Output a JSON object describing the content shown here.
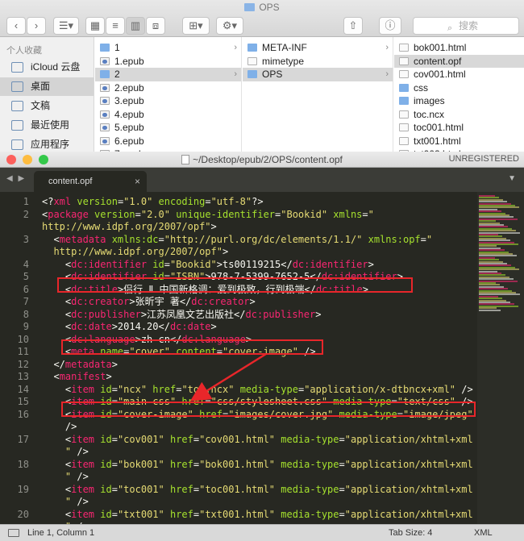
{
  "finder": {
    "title": "OPS",
    "search_placeholder": "搜索",
    "sidebar": {
      "header": "个人收藏",
      "items": [
        {
          "label": "iCloud 云盘",
          "icon": "cloud-icon"
        },
        {
          "label": "桌面",
          "icon": "desktop-icon",
          "selected": true
        },
        {
          "label": "文稿",
          "icon": "documents-icon"
        },
        {
          "label": "最近使用",
          "icon": "clock-icon"
        },
        {
          "label": "应用程序",
          "icon": "applications-icon"
        }
      ]
    },
    "col1": [
      {
        "label": "1",
        "type": "folder",
        "chevron": true
      },
      {
        "label": "1.epub",
        "type": "epub"
      },
      {
        "label": "2",
        "type": "folder",
        "chevron": true,
        "selected": true
      },
      {
        "label": "2.epub",
        "type": "epub"
      },
      {
        "label": "3.epub",
        "type": "epub"
      },
      {
        "label": "4.epub",
        "type": "epub"
      },
      {
        "label": "5.epub",
        "type": "epub"
      },
      {
        "label": "6.epub",
        "type": "epub"
      },
      {
        "label": "7.epub",
        "type": "epub"
      }
    ],
    "col2": [
      {
        "label": "META-INF",
        "type": "folder",
        "chevron": true
      },
      {
        "label": "mimetype",
        "type": "doc"
      },
      {
        "label": "OPS",
        "type": "folder",
        "chevron": true,
        "selected": true
      }
    ],
    "col3": [
      {
        "label": "bok001.html",
        "type": "doc"
      },
      {
        "label": "content.opf",
        "type": "doc",
        "selected": true
      },
      {
        "label": "cov001.html",
        "type": "doc"
      },
      {
        "label": "css",
        "type": "folder"
      },
      {
        "label": "images",
        "type": "folder"
      },
      {
        "label": "toc.ncx",
        "type": "doc"
      },
      {
        "label": "toc001.html",
        "type": "doc"
      },
      {
        "label": "txt001.html",
        "type": "doc"
      },
      {
        "label": "txt002.html",
        "type": "doc"
      }
    ]
  },
  "editor": {
    "window_title": "~/Desktop/epub/2/OPS/content.opf",
    "unregistered": "UNREGISTERED",
    "tab_label": "content.opf",
    "status": {
      "position": "Line 1, Column 1",
      "tab_size": "Tab Size: 4",
      "syntax": "XML"
    },
    "line_numbers": [
      "1",
      "2",
      "3",
      "4",
      "5",
      "6",
      "7",
      "8",
      "9",
      "10",
      "11",
      "12",
      "13",
      "14",
      "15",
      "16",
      "17",
      "18",
      "19",
      "20"
    ],
    "colors": {
      "background": "#272822",
      "tag": "#f92672",
      "attribute": "#a6e22e",
      "string": "#e6db74",
      "text": "#f8f8f2",
      "highlight": "#e8262a"
    },
    "lines": [
      [
        [
          "p",
          "<?"
        ],
        [
          "t",
          "xml"
        ],
        [
          "a",
          " version"
        ],
        [
          "p",
          "="
        ],
        [
          "s",
          "\"1.0\""
        ],
        [
          "a",
          " encoding"
        ],
        [
          "p",
          "="
        ],
        [
          "s",
          "\"utf-8\""
        ],
        [
          "p",
          "?>"
        ]
      ],
      [
        [
          "p",
          "<"
        ],
        [
          "t",
          "package"
        ],
        [
          "a",
          " version"
        ],
        [
          "p",
          "="
        ],
        [
          "s",
          "\"2.0\""
        ],
        [
          "a",
          " unique-identifier"
        ],
        [
          "p",
          "="
        ],
        [
          "s",
          "\"Bookid\""
        ],
        [
          "a",
          " xmlns"
        ],
        [
          "p",
          "="
        ],
        [
          "s",
          "\""
        ]
      ],
      [
        [
          "s",
          "http://www.idpf.org/2007/opf\""
        ],
        [
          "p",
          ">"
        ]
      ],
      [
        [
          "p",
          "  <"
        ],
        [
          "t",
          "metadata"
        ],
        [
          "a",
          " xmlns:dc"
        ],
        [
          "p",
          "="
        ],
        [
          "s",
          "\"http://purl.org/dc/elements/1.1/\""
        ],
        [
          "a",
          " xmlns:opf"
        ],
        [
          "p",
          "="
        ],
        [
          "s",
          "\""
        ]
      ],
      [
        [
          "s",
          "  http://www.idpf.org/2007/opf\""
        ],
        [
          "p",
          ">"
        ]
      ],
      [
        [
          "p",
          "    <"
        ],
        [
          "t",
          "dc:identifier"
        ],
        [
          "a",
          " id"
        ],
        [
          "p",
          "="
        ],
        [
          "s",
          "\"Bookid\""
        ],
        [
          "p",
          ">ts00119215</"
        ],
        [
          "t",
          "dc:identifier"
        ],
        [
          "p",
          ">"
        ]
      ],
      [
        [
          "p",
          "    <"
        ],
        [
          "t",
          "dc:identifier"
        ],
        [
          "a",
          " id"
        ],
        [
          "p",
          "="
        ],
        [
          "s",
          "\"ISBN\""
        ],
        [
          "p",
          ">978-7-5399-7652-5</"
        ],
        [
          "t",
          "dc:identifier"
        ],
        [
          "p",
          ">"
        ]
      ],
      [
        [
          "p",
          "    <"
        ],
        [
          "t",
          "dc:title"
        ],
        [
          "p",
          ">侣行 Ⅱ 中国新格调：爱到极致，行到极端</"
        ],
        [
          "t",
          "dc:title"
        ],
        [
          "p",
          ">"
        ]
      ],
      [
        [
          "p",
          "    <"
        ],
        [
          "t",
          "dc:creator"
        ],
        [
          "p",
          ">张昕宇 著</"
        ],
        [
          "t",
          "dc:creator"
        ],
        [
          "p",
          ">"
        ]
      ],
      [
        [
          "p",
          "    <"
        ],
        [
          "t",
          "dc:publisher"
        ],
        [
          "p",
          ">江苏凤凰文艺出版社</"
        ],
        [
          "t",
          "dc:publisher"
        ],
        [
          "p",
          ">"
        ]
      ],
      [
        [
          "p",
          "    <"
        ],
        [
          "t",
          "dc:date"
        ],
        [
          "p",
          ">2014.20</"
        ],
        [
          "t",
          "dc:date"
        ],
        [
          "p",
          ">"
        ]
      ],
      [
        [
          "p",
          "    <"
        ],
        [
          "t",
          "dc:language"
        ],
        [
          "p",
          ">zh-cn</"
        ],
        [
          "t",
          "dc:language"
        ],
        [
          "p",
          ">"
        ]
      ],
      [
        [
          "p",
          "    <"
        ],
        [
          "t",
          "meta"
        ],
        [
          "a",
          " name"
        ],
        [
          "p",
          "="
        ],
        [
          "s",
          "\"cover\""
        ],
        [
          "a",
          " content"
        ],
        [
          "p",
          "="
        ],
        [
          "s",
          "\"cover-image\""
        ],
        [
          "p",
          " />"
        ]
      ],
      [
        [
          "p",
          "  </"
        ],
        [
          "t",
          "metadata"
        ],
        [
          "p",
          ">"
        ]
      ],
      [
        [
          "p",
          "  <"
        ],
        [
          "t",
          "manifest"
        ],
        [
          "p",
          ">"
        ]
      ],
      [
        [
          "p",
          "    <"
        ],
        [
          "t",
          "item"
        ],
        [
          "a",
          " id"
        ],
        [
          "p",
          "="
        ],
        [
          "s",
          "\"ncx\""
        ],
        [
          "a",
          " href"
        ],
        [
          "p",
          "="
        ],
        [
          "s",
          "\"toc.ncx\""
        ],
        [
          "a",
          " media-type"
        ],
        [
          "p",
          "="
        ],
        [
          "s",
          "\"application/x-dtbncx+xml\""
        ],
        [
          "p",
          " />"
        ]
      ],
      [
        [
          "p",
          "    <"
        ],
        [
          "t",
          "item"
        ],
        [
          "a",
          " id"
        ],
        [
          "p",
          "="
        ],
        [
          "s",
          "\"main-css\""
        ],
        [
          "a",
          " href"
        ],
        [
          "p",
          "="
        ],
        [
          "s",
          "\"css/stylesheet.css\""
        ],
        [
          "a",
          " media-type"
        ],
        [
          "p",
          "="
        ],
        [
          "s",
          "\"text/css\""
        ],
        [
          "p",
          " />"
        ]
      ],
      [
        [
          "p",
          "    <"
        ],
        [
          "t",
          "item"
        ],
        [
          "a",
          " id"
        ],
        [
          "p",
          "="
        ],
        [
          "s",
          "\"cover-image\""
        ],
        [
          "a",
          " href"
        ],
        [
          "p",
          "="
        ],
        [
          "s",
          "\"images/cover.jpg\""
        ],
        [
          "a",
          " media-type"
        ],
        [
          "p",
          "="
        ],
        [
          "s",
          "\"image/jpeg\""
        ]
      ],
      [
        [
          "p",
          "    />"
        ]
      ],
      [
        [
          "p",
          "    <"
        ],
        [
          "t",
          "item"
        ],
        [
          "a",
          " id"
        ],
        [
          "p",
          "="
        ],
        [
          "s",
          "\"cov001\""
        ],
        [
          "a",
          " href"
        ],
        [
          "p",
          "="
        ],
        [
          "s",
          "\"cov001.html\""
        ],
        [
          "a",
          " media-type"
        ],
        [
          "p",
          "="
        ],
        [
          "s",
          "\"application/xhtml+xml"
        ]
      ],
      [
        [
          "s",
          "    \""
        ],
        [
          "p",
          " />"
        ]
      ],
      [
        [
          "p",
          "    <"
        ],
        [
          "t",
          "item"
        ],
        [
          "a",
          " id"
        ],
        [
          "p",
          "="
        ],
        [
          "s",
          "\"bok001\""
        ],
        [
          "a",
          " href"
        ],
        [
          "p",
          "="
        ],
        [
          "s",
          "\"bok001.html\""
        ],
        [
          "a",
          " media-type"
        ],
        [
          "p",
          "="
        ],
        [
          "s",
          "\"application/xhtml+xml"
        ]
      ],
      [
        [
          "s",
          "    \""
        ],
        [
          "p",
          " />"
        ]
      ],
      [
        [
          "p",
          "    <"
        ],
        [
          "t",
          "item"
        ],
        [
          "a",
          " id"
        ],
        [
          "p",
          "="
        ],
        [
          "s",
          "\"toc001\""
        ],
        [
          "a",
          " href"
        ],
        [
          "p",
          "="
        ],
        [
          "s",
          "\"toc001.html\""
        ],
        [
          "a",
          " media-type"
        ],
        [
          "p",
          "="
        ],
        [
          "s",
          "\"application/xhtml+xml"
        ]
      ],
      [
        [
          "s",
          "    \""
        ],
        [
          "p",
          " />"
        ]
      ],
      [
        [
          "p",
          "    <"
        ],
        [
          "t",
          "item"
        ],
        [
          "a",
          " id"
        ],
        [
          "p",
          "="
        ],
        [
          "s",
          "\"txt001\""
        ],
        [
          "a",
          " href"
        ],
        [
          "p",
          "="
        ],
        [
          "s",
          "\"txt001.html\""
        ],
        [
          "a",
          " media-type"
        ],
        [
          "p",
          "="
        ],
        [
          "s",
          "\"application/xhtml+xml"
        ]
      ],
      [
        [
          "s",
          "    \""
        ],
        [
          "p",
          " />"
        ]
      ]
    ]
  }
}
